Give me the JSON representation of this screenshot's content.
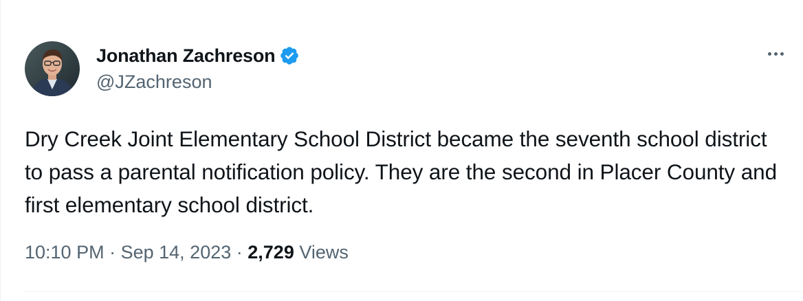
{
  "author": {
    "display_name": "Jonathan Zachreson",
    "handle": "@JZachreson",
    "verified": true,
    "verified_color": "#1d9bf0"
  },
  "tweet": {
    "text": "Dry Creek Joint Elementary School District became the seventh school district to pass a parental notification policy. They are the second in Placer County and first elementary school district.",
    "time": "10:10 PM",
    "separator": "·",
    "date": "Sep 14, 2023",
    "views_count": "2,729",
    "views_label": "Views"
  },
  "icons": {
    "more": "more-icon",
    "verified": "verified-badge-icon"
  }
}
